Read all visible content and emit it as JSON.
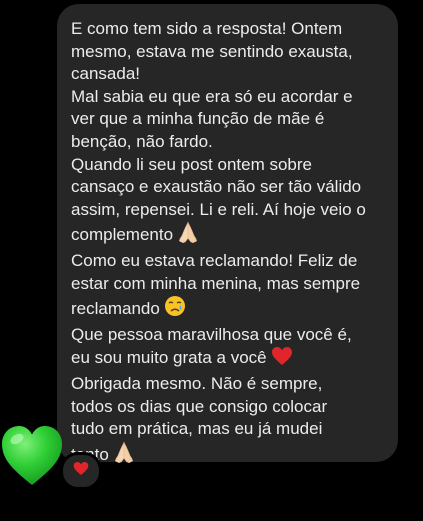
{
  "message": {
    "paragraphs": [
      {
        "lines": [
          "E como tem sido a resposta! Ontem",
          "mesmo, estava me sentindo exausta,",
          "cansada!"
        ]
      },
      {
        "lines": [
          "Mal sabia eu que era só eu acordar e",
          "ver que a minha função de mãe é",
          "benção, não fardo."
        ]
      },
      {
        "lines": [
          "Quando li seu post ontem sobre",
          "cansaço e exaustão não ser tão válido",
          "assim, repensei. Li e reli. Aí hoje veio o",
          "complemento"
        ],
        "end_icon": "praying-hands-emoji"
      },
      {
        "lines": [
          "Como eu estava reclamando! Feliz de",
          "estar com minha menina, mas sempre",
          "reclamando"
        ],
        "end_icon": "crying-face-emoji"
      },
      {
        "lines": [
          "Que pessoa maravilhosa que você é,",
          "eu sou muito grata a você"
        ],
        "end_icon": "red-heart-emoji"
      },
      {
        "lines": [
          "Obrigada mesmo. Não é sempre,",
          "todos os dias que consigo colocar",
          "tudo em prática, mas eu já mudei",
          "tanto"
        ],
        "end_icon": "praying-hands-emoji"
      }
    ]
  },
  "sticker": {
    "icon": "green-heart-emoji",
    "color": "#22c22e"
  },
  "reaction": {
    "icon": "red-heart-emoji",
    "color": "#e0262b"
  },
  "colors": {
    "background": "#000000",
    "bubble": "#262626",
    "text": "#ececec"
  }
}
